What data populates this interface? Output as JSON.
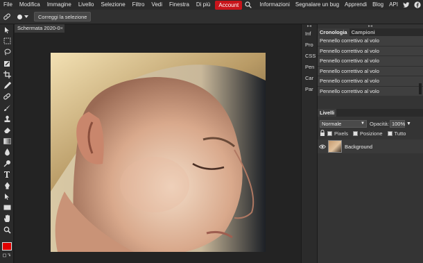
{
  "menubar": {
    "items": [
      "File",
      "Modifica",
      "Immagine",
      "Livello",
      "Selezione",
      "Filtro",
      "Vedi",
      "Finestra",
      "Di più"
    ],
    "account": "Account",
    "right": [
      "Informazioni",
      "Segnalare un bug",
      "Apprendi",
      "Blog",
      "API"
    ]
  },
  "options": {
    "refine_button": "Correggi la selezione"
  },
  "document": {
    "tab_title": "Schermata 2020-0",
    "tab_close": "×"
  },
  "mini_panel": {
    "items": [
      "Inf",
      "Pro",
      "CSS",
      "Pen",
      "Car",
      "Par"
    ]
  },
  "history": {
    "tabs": [
      "Cronologia",
      "Campioni"
    ],
    "rows": [
      "Pennello correttivo al volo",
      "Pennello correttivo al volo",
      "Pennello correttivo al volo",
      "Pennello correttivo al volo",
      "Pennello correttivo al volo",
      "Pennello correttivo al volo"
    ]
  },
  "layers": {
    "tab": "Livelli",
    "blend_mode": "Normale",
    "opacity_label": "Opacità:",
    "opacity_value": "100%",
    "lock_labels": [
      "Pixels",
      "Posizione",
      "Tutto"
    ],
    "layer_name": "Background"
  },
  "colors": {
    "accent": "#c8141b",
    "foreground_swatch": "#e00000"
  }
}
